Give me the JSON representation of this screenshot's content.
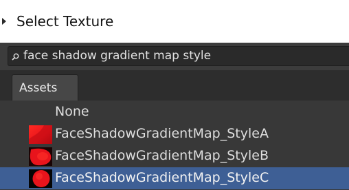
{
  "window": {
    "title": "Select Texture"
  },
  "search": {
    "value": "face shadow gradient map style"
  },
  "tabs": [
    {
      "label": "Assets"
    }
  ],
  "items": [
    {
      "label": "None",
      "thumbnail": "none",
      "selected": false
    },
    {
      "label": "FaceShadowGradientMap_StyleA",
      "thumbnail": "red-diagonal-gradient",
      "selected": false
    },
    {
      "label": "FaceShadowGradientMap_StyleB",
      "thumbnail": "red-dark-blob",
      "selected": false
    },
    {
      "label": "FaceShadowGradientMap_StyleC",
      "thumbnail": "red-circle-on-black",
      "selected": true
    }
  ],
  "colors": {
    "selection": "#3e5f95",
    "thumbnail_red": "#e8141c",
    "window_bg": "#383838"
  }
}
